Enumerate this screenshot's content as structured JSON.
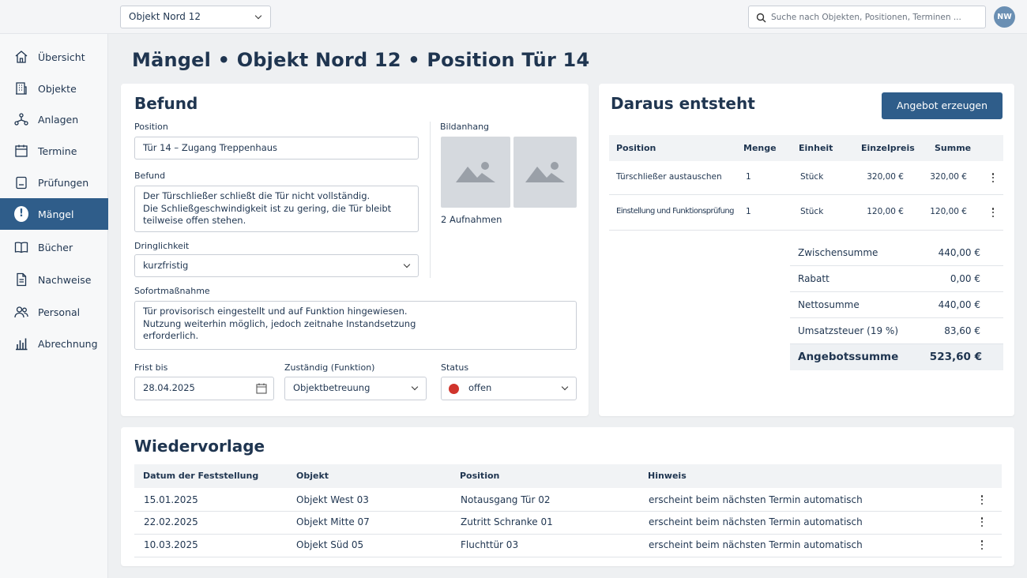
{
  "topbar": {
    "object_select": "Objekt Nord 12",
    "search_placeholder": "Suche nach Objekten, Positionen, Terminen ...",
    "avatar_initials": "NW"
  },
  "sidebar": {
    "items": [
      {
        "label": "Übersicht",
        "icon": "home-icon"
      },
      {
        "label": "Objekte",
        "icon": "building-icon"
      },
      {
        "label": "Anlagen",
        "icon": "network-icon"
      },
      {
        "label": "Termine",
        "icon": "calendar-icon"
      },
      {
        "label": "Prüfungen",
        "icon": "clipboard-icon"
      },
      {
        "label": "Mängel",
        "icon": "alert-badge-icon",
        "badge": "!"
      },
      {
        "label": "Bücher",
        "icon": "book-icon"
      },
      {
        "label": "Nachweise",
        "icon": "document-icon"
      },
      {
        "label": "Personal",
        "icon": "people-icon"
      },
      {
        "label": "Abrechnung",
        "icon": "bar-chart-icon"
      }
    ],
    "active_index": 5
  },
  "page": {
    "title": "Mängel • Objekt Nord 12 • Position Tür 14"
  },
  "befund": {
    "title": "Befund",
    "position_label": "Position",
    "position_value": "Tür 14 – Zugang Treppenhaus",
    "befund_label": "Befund",
    "befund_lines": [
      "Der Türschließer schließt die Tür nicht vollständig.",
      "Die Schließgeschwindigkeit ist zu gering, die Tür bleibt",
      "teilweise offen stehen."
    ],
    "dringlichkeit_label": "Dringlichkeit",
    "dringlichkeit_value": "kurzfristig",
    "sofort_label": "Sofortmaßnahme",
    "sofort_lines": [
      "Tür provisorisch eingestellt und auf Funktion hingewiesen.",
      "Nutzung weiterhin möglich, jedoch zeitnahe Instandsetzung",
      "erforderlich."
    ],
    "bildanhang_label": "Bildanhang",
    "aufnahmen": "2 Aufnahmen",
    "frist_label": "Frist bis",
    "frist_value": "28.04.2025",
    "zustaendig_label": "Zuständig (Funktion)",
    "zustaendig_value": "Objektbetreuung",
    "status_label": "Status",
    "status_value": "offen",
    "status_color": "#d0342c"
  },
  "angebot": {
    "title": "Daraus entsteht",
    "button": "Angebot erzeugen",
    "headers": [
      "Position",
      "Menge",
      "Einheit",
      "Einzelpreis",
      "Summe"
    ],
    "rows": [
      {
        "position": "Türschließer austauschen",
        "menge": "1",
        "einheit": "Stück",
        "einzelpreis": "320,00 €",
        "summe": "320,00 €"
      },
      {
        "position": "Einstellung und Funktionsprüfung",
        "menge": "1",
        "einheit": "Stück",
        "einzelpreis": "120,00 €",
        "summe": "120,00 €"
      }
    ],
    "summary": [
      {
        "label": "Zwischensumme",
        "value": "440,00 €"
      },
      {
        "label": "Rabatt",
        "value": "0,00 €"
      },
      {
        "label": "Nettosumme",
        "value": "440,00 €"
      },
      {
        "label": "Umsatzsteuer (19 %)",
        "value": "83,60 €"
      }
    ],
    "total_label": "Angebotssumme",
    "total_value": "523,60 €"
  },
  "wiedervorlage": {
    "title": "Wiedervorlage",
    "headers": [
      "Datum der Feststellung",
      "Objekt",
      "Position",
      "Hinweis"
    ],
    "rows": [
      {
        "datum": "15.01.2025",
        "objekt": "Objekt West 03",
        "position": "Notausgang Tür 02",
        "hinweis": "erscheint beim nächsten Termin automatisch"
      },
      {
        "datum": "22.02.2025",
        "objekt": "Objekt Mitte 07",
        "position": "Zutritt Schranke 01",
        "hinweis": "erscheint beim nächsten Termin automatisch"
      },
      {
        "datum": "10.03.2025",
        "objekt": "Objekt Süd 05",
        "position": "Fluchttür 03",
        "hinweis": "erscheint beim nächsten Termin automatisch"
      }
    ]
  }
}
